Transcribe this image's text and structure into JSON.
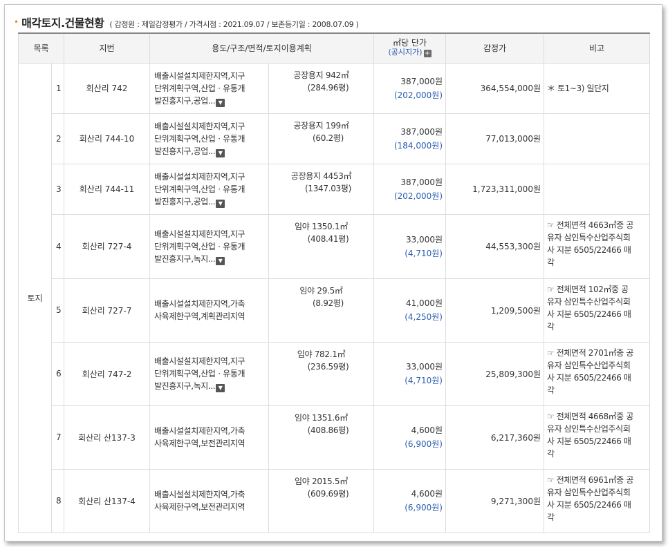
{
  "header": {
    "bullet": "•",
    "title": "매각토지.건물현황",
    "meta": "( 감정원 : 제일감정평가 / 가격시점 : 2021.09.07 / 보존등기일 : 2008.07.09 )"
  },
  "columns": {
    "category": "목록",
    "lot": "지번",
    "use": "용도/구조/면적/토지이용계획",
    "unit_price": "㎡당 단가",
    "unit_price_sub": "(공시지가)",
    "unit_price_plus": "+",
    "appraisal": "감정가",
    "note": "비고"
  },
  "category_label": "토지",
  "rows": [
    {
      "no": "1",
      "lot": "회산리 742",
      "use_lines": [
        "배출시설설치제한지역,지구",
        "단위계획구역,산업ㆍ유통개",
        "발진흥지구,공업..."
      ],
      "area": "공장용지 942㎡",
      "pyeong": "(284.96평)",
      "price": "387,000원",
      "public": "(202,000원)",
      "appraisal": "364,554,000원",
      "note_lines": [
        "＊ 토1~3) 일단지"
      ]
    },
    {
      "no": "2",
      "lot": "회산리 744-10",
      "use_lines": [
        "배출시설설치제한지역,지구",
        "단위계획구역,산업ㆍ유통개",
        "발진흥지구,공업..."
      ],
      "area": "공장용지 199㎡",
      "pyeong": "(60.2평)",
      "price": "387,000원",
      "public": "(184,000원)",
      "appraisal": "77,013,000원",
      "note_lines": []
    },
    {
      "no": "3",
      "lot": "회산리 744-11",
      "use_lines": [
        "배출시설설치제한지역,지구",
        "단위계획구역,산업ㆍ유통개",
        "발진흥지구,공업..."
      ],
      "area": "공장용지 4453㎡",
      "pyeong": "(1347.03평)",
      "price": "387,000원",
      "public": "(202,000원)",
      "appraisal": "1,723,311,000원",
      "note_lines": []
    },
    {
      "no": "4",
      "lot": "회산리 727-4",
      "use_lines": [
        "배출시설설치제한지역,지구",
        "단위계획구역,산업ㆍ유통개",
        "발진흥지구,녹지..."
      ],
      "area": "임야 1350.1㎡",
      "pyeong": "(408.41평)",
      "price": "33,000원",
      "public": "(4,710원)",
      "appraisal": "44,553,300원",
      "note_lines": [
        "☞ 전체면적 4663㎡중 공",
        "유자 삼인특수산업주식회",
        "사 지분 6505/22466 매",
        "각"
      ]
    },
    {
      "no": "5",
      "lot": "회산리 727-7",
      "use_lines": [
        "배출시설설치제한지역,가축",
        "사육제한구역,계획관리지역"
      ],
      "area": "임야 29.5㎡",
      "pyeong": "(8.92평)",
      "price": "41,000원",
      "public": "(4,250원)",
      "appraisal": "1,209,500원",
      "note_lines": [
        "☞ 전체면적 102㎡중 공",
        "유자 삼인특수산업주식회",
        "사 지분 6505/22466 매",
        "각"
      ]
    },
    {
      "no": "6",
      "lot": "회산리 747-2",
      "use_lines": [
        "배출시설설치제한지역,지구",
        "단위계획구역,산업ㆍ유통개",
        "발진흥지구,녹지..."
      ],
      "area": "임야 782.1㎡",
      "pyeong": "(236.59평)",
      "price": "33,000원",
      "public": "(4,710원)",
      "appraisal": "25,809,300원",
      "note_lines": [
        "☞ 전체면적 2701㎡중 공",
        "유자 삼인특수산업주식회",
        "사 지분 6505/22466 매",
        "각"
      ]
    },
    {
      "no": "7",
      "lot": "회산리 산137-3",
      "use_lines": [
        "배출시설설치제한지역,가축",
        "사육제한구역,보전관리지역"
      ],
      "area": "임야 1351.6㎡",
      "pyeong": "(408.86평)",
      "price": "4,600원",
      "public": "(6,900원)",
      "appraisal": "6,217,360원",
      "note_lines": [
        "☞ 전체면적 4668㎡중 공",
        "유자 삼인특수산업주식회",
        "사 지분 6505/22466 매",
        "각"
      ]
    },
    {
      "no": "8",
      "lot": "회산리 산137-4",
      "use_lines": [
        "배출시설설치제한지역,가축",
        "사육제한구역,보전관리지역"
      ],
      "area": "임야 2015.5㎡",
      "pyeong": "(609.69평)",
      "price": "4,600원",
      "public": "(6,900원)",
      "appraisal": "9,271,300원",
      "note_lines": [
        "☞ 전체면적 6961㎡중 공",
        "유자 삼인특수산업주식회",
        "사 지분 6505/22466 매",
        "각"
      ]
    }
  ],
  "more_icon": "chevron-down-icon"
}
